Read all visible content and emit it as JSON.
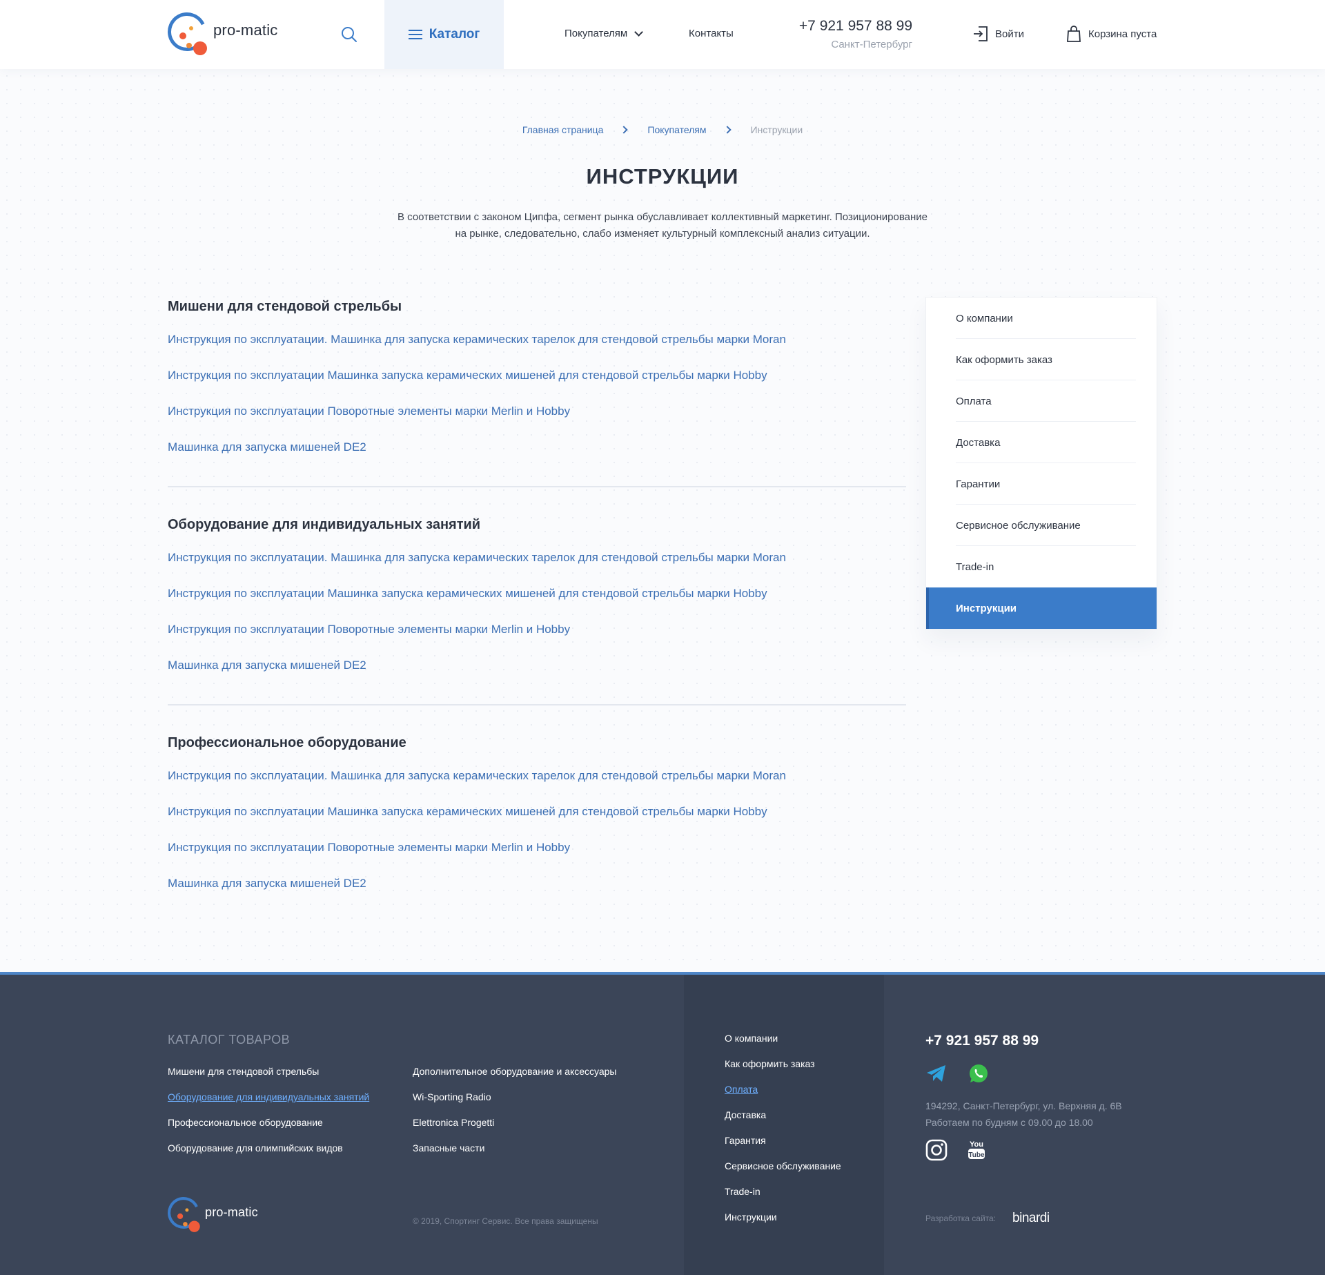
{
  "header": {
    "logo_text": "pro-matic",
    "catalog_label": "Каталог",
    "nav": {
      "buyers": "Покупателям",
      "contacts": "Контакты"
    },
    "phone": "+7 921 957 88 99",
    "city": "Санкт-Петербург",
    "login": "Войти",
    "cart": "Корзина пуста"
  },
  "breadcrumb": {
    "home": "Главная страница",
    "buyers": "Покупателям",
    "current": "Инструкции"
  },
  "page": {
    "title": "ИНСТРУКЦИИ",
    "intro_line1": "В соответствии с законом Ципфа, сегмент рынка обуславливает коллективный маркетинг. Позиционирование",
    "intro_line2": "на рынке, следовательно, слабо изменяет культурный комплексный анализ ситуации."
  },
  "sections": [
    {
      "title": "Мишени для стендовой стрельбы",
      "links": [
        "Инструкция по эксплуатации. Машинка для запуска керамических тарелок для стендовой стрельбы марки Moran",
        "Инструкция по эксплуатации Машинка запуска керамических мишеней для стендовой стрельбы марки Hobby",
        "Инструкция по эксплуатации Поворотные элементы марки Merlin и Hobby",
        "Машинка для запуска мишеней DE2"
      ]
    },
    {
      "title": "Оборудование для индивидуальных занятий",
      "links": [
        "Инструкция по эксплуатации. Машинка для запуска керамических тарелок для стендовой стрельбы марки Moran",
        "Инструкция по эксплуатации Машинка запуска керамических мишеней для стендовой стрельбы марки Hobby",
        "Инструкция по эксплуатации Поворотные элементы марки Merlin и Hobby",
        "Машинка для запуска мишеней DE2"
      ]
    },
    {
      "title": "Профессиональное оборудование",
      "links": [
        "Инструкция по эксплуатации. Машинка для запуска керамических тарелок для стендовой стрельбы марки Moran",
        "Инструкция по эксплуатации Машинка запуска керамических мишеней для стендовой стрельбы марки Hobby",
        "Инструкция по эксплуатации Поворотные элементы марки Merlin и Hobby",
        "Машинка для запуска мишеней DE2"
      ]
    }
  ],
  "sidebar": {
    "items": [
      "О компании",
      "Как оформить заказ",
      "Оплата",
      "Доставка",
      "Гарантии",
      "Сервисное обслуживание",
      "Trade-in",
      "Инструкции"
    ],
    "active": "Инструкции"
  },
  "footer": {
    "catalog_title": "КАТАЛОГ ТОВАРОВ",
    "catalog_col1": [
      "Мишени для стендовой стрельбы",
      "Оборудование для индивидуальных занятий",
      "Профессиональное оборудование",
      "Оборудование для олимпийских видов"
    ],
    "catalog_col2": [
      "Дополнительное оборудование и аксессуары",
      "Wi-Sporting Radio",
      "Elettronica Progetti",
      "Запасные части"
    ],
    "logo_text": "pro-matic",
    "copyright": "© 2019, Спортинг Сервис. Все права защищены",
    "menu": [
      "О компании",
      "Как оформить заказ",
      "Оплата",
      "Доставка",
      "Гарантия",
      "Сервисное обслуживание",
      "Trade-in",
      "Инструкции"
    ],
    "phone": "+7 921 957 88 99",
    "address_line1": "194292, Санкт-Петербург, ул. Верхняя д. 6В",
    "address_line2": "Работаем по будням с 09.00 до 18.00",
    "dev_label": "Разработка сайта:",
    "dev_brand": "binardi"
  },
  "icons": {
    "search": "search-icon",
    "menu": "menu-icon",
    "login": "login-icon",
    "cart": "shopping-bag-icon",
    "telegram": "telegram-icon",
    "whatsapp": "whatsapp-icon",
    "instagram": "instagram-icon",
    "youtube": "youtube-icon"
  },
  "colors": {
    "accent": "#3b7cc9",
    "link": "#3c6fb4",
    "logo_orange": "#ef5b3a",
    "footer_bg": "#3b4558",
    "telegram": "#2ea3de",
    "whatsapp": "#3bbf4d"
  }
}
